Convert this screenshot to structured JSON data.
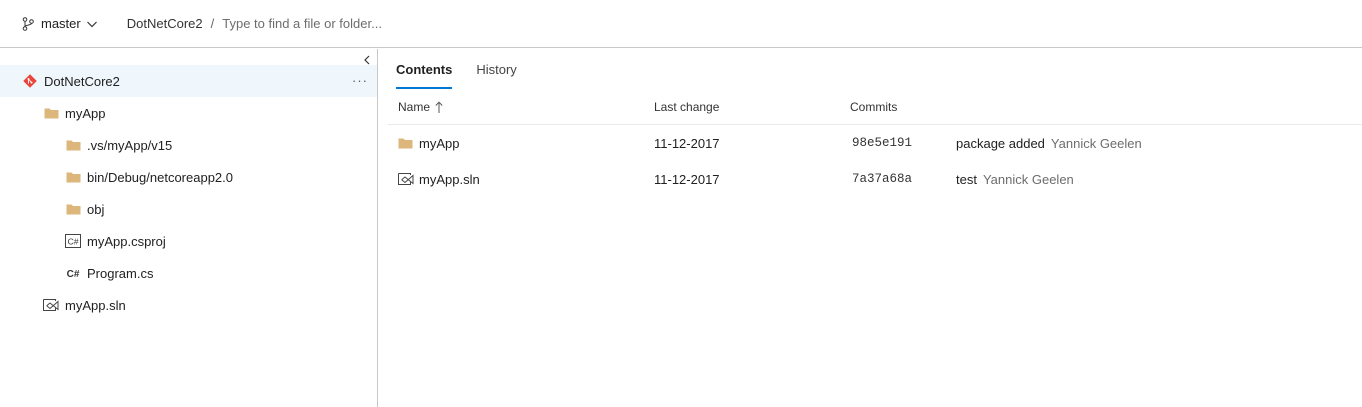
{
  "header": {
    "branch": "master",
    "repo": "DotNetCore2",
    "separator": "/",
    "find_placeholder": "Type to find a file or folder..."
  },
  "tree": {
    "items": [
      {
        "label": "DotNetCore2",
        "icon": "git-repo-icon",
        "selected": true
      },
      {
        "label": "myApp",
        "icon": "folder-icon"
      },
      {
        "label": ".vs/myApp/v15",
        "icon": "folder-icon"
      },
      {
        "label": "bin/Debug/netcoreapp2.0",
        "icon": "folder-icon"
      },
      {
        "label": "obj",
        "icon": "folder-icon"
      },
      {
        "label": "myApp.csproj",
        "icon": "csproj-icon"
      },
      {
        "label": "Program.cs",
        "icon": "csharp-file-icon"
      },
      {
        "label": "myApp.sln",
        "icon": "solution-file-icon"
      }
    ],
    "more_label": "···"
  },
  "tabs": [
    {
      "label": "Contents",
      "active": true
    },
    {
      "label": "History",
      "active": false
    }
  ],
  "columns": {
    "name": "Name",
    "last_change": "Last change",
    "commits": "Commits"
  },
  "files": [
    {
      "name": "myApp",
      "icon": "folder-icon",
      "last_change": "11-12-2017",
      "commit": "98e5e191",
      "message": "package added",
      "author": "Yannick Geelen"
    },
    {
      "name": "myApp.sln",
      "icon": "solution-file-icon",
      "last_change": "11-12-2017",
      "commit": "7a37a68a",
      "message": "test",
      "author": "Yannick Geelen"
    }
  ],
  "colors": {
    "accent": "#0078d4",
    "folder": "#dcb67a",
    "git": "#e8463a",
    "selected_row": "#eff6fc"
  }
}
